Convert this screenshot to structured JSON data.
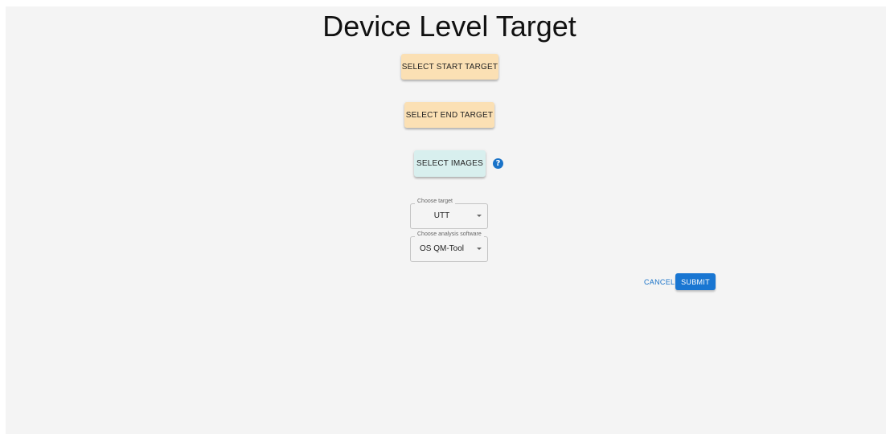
{
  "page": {
    "title": "Device Level Target"
  },
  "actions": {
    "select_start_target": "SELECT START TARGET",
    "select_end_target": "SELECT END TARGET",
    "select_images": "SELECT IMAGES",
    "help_icon": "question-circle",
    "help_glyph": "?"
  },
  "form": {
    "target": {
      "label": "Choose target",
      "value": "UTT"
    },
    "analysis_software": {
      "label": "Choose analysis software",
      "value": "OS QM-Tool"
    }
  },
  "footer": {
    "cancel_label": "CANCEL",
    "submit_label": "SUBMIT"
  },
  "colors": {
    "background": "#f4f4f4",
    "orange_button": "#fbe0b4",
    "teal_button": "#d8efee",
    "primary": "#1976d2"
  }
}
